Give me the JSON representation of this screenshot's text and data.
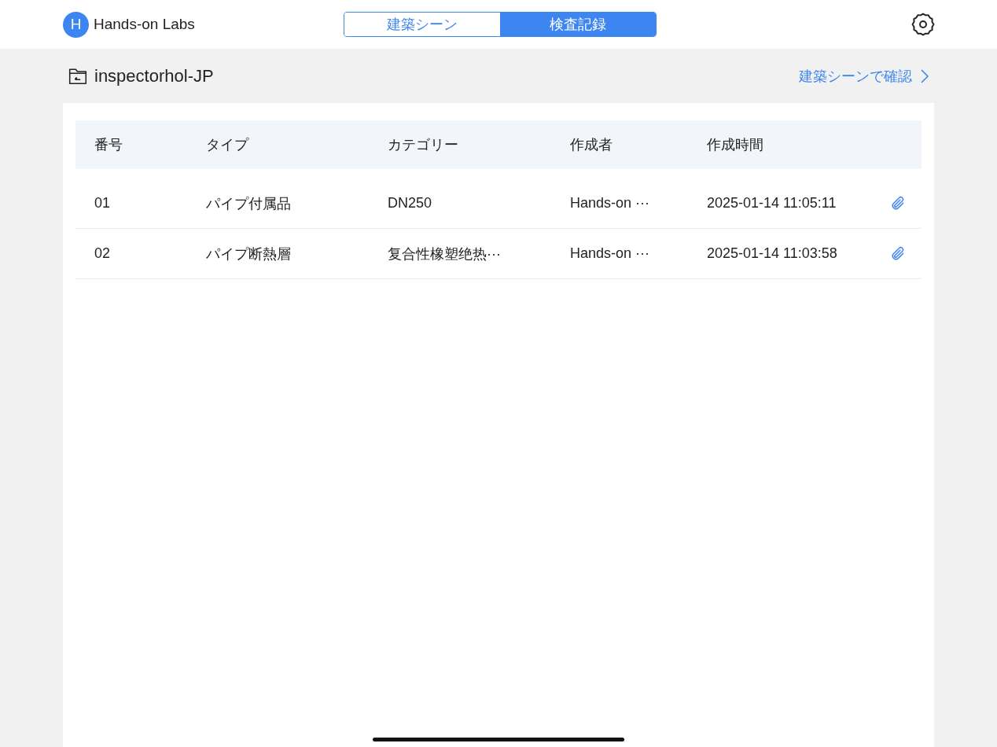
{
  "app": {
    "avatar_initial": "H",
    "name": "Hands-on Labs"
  },
  "tabs": [
    {
      "label": "建築シーン",
      "selected": false
    },
    {
      "label": "検査記録",
      "selected": true
    }
  ],
  "project": {
    "name": "inspectorhol-JP",
    "link": "建築シーンで確認"
  },
  "table": {
    "columns": [
      "番号",
      "タイプ",
      "カテゴリー",
      "作成者",
      "作成時間"
    ],
    "rows": [
      {
        "cells": [
          "01",
          "パイプ付属品",
          "DN250",
          "Hands-on ···",
          "2025-01-14 11:05:11"
        ],
        "attachment": true
      },
      {
        "cells": [
          "02",
          "パイプ断熱層",
          "复合性橡塑绝热···",
          "Hands-on ···",
          "2025-01-14 11:03:58"
        ],
        "attachment": true
      }
    ]
  }
}
